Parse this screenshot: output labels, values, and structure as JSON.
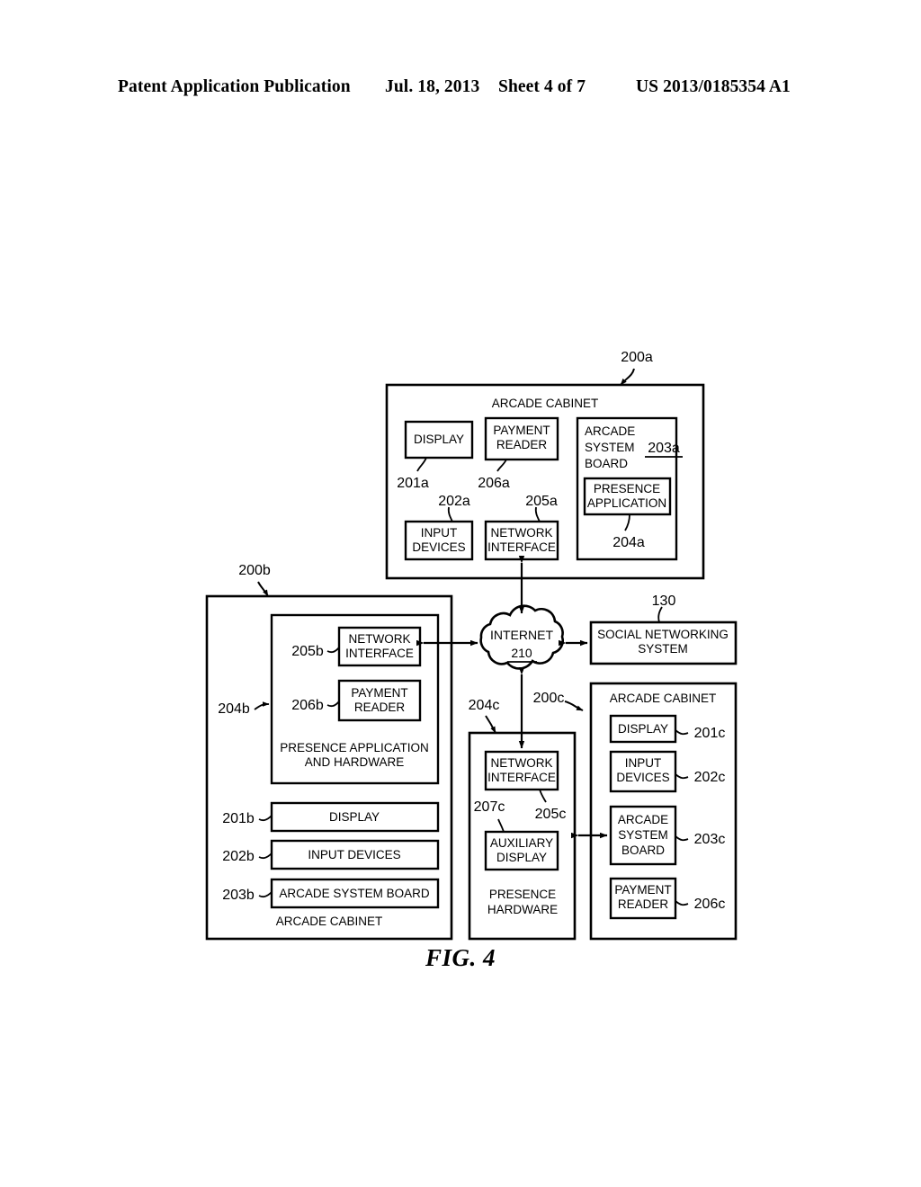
{
  "header": {
    "publication": "Patent Application Publication",
    "date": "Jul. 18, 2013",
    "sheet": "Sheet 4 of 7",
    "number": "US 2013/0185354 A1"
  },
  "figure": {
    "caption": "FIG. 4",
    "blocks": {
      "cabinet_a": {
        "ref": "200a",
        "title": "ARCADE CABINET",
        "display": {
          "label": "DISPLAY",
          "ref": "201a"
        },
        "payment_reader": {
          "label_line1": "PAYMENT",
          "label_line2": "READER",
          "ref": "206a"
        },
        "input_devices": {
          "label_line1": "INPUT",
          "label_line2": "DEVICES",
          "ref": "202a"
        },
        "network_interface": {
          "label_line1": "NETWORK",
          "label_line2": "INTERFACE",
          "ref": "205a"
        },
        "system_board": {
          "label_line1": "ARCADE",
          "label_line2": "SYSTEM",
          "label_line3": "BOARD",
          "ref": "203a"
        },
        "presence_application": {
          "label_line1": "PRESENCE",
          "label_line2": "APPLICATION",
          "ref": "204a"
        }
      },
      "cabinet_b": {
        "ref": "200b",
        "title": "ARCADE CABINET",
        "presence_module": {
          "label_line1": "PRESENCE APPLICATION",
          "label_line2": "AND HARDWARE",
          "ref": "204b"
        },
        "network_interface": {
          "label_line1": "NETWORK",
          "label_line2": "INTERFACE",
          "ref": "205b"
        },
        "payment_reader": {
          "label_line1": "PAYMENT",
          "label_line2": "READER",
          "ref": "206b"
        },
        "display": {
          "label": "DISPLAY",
          "ref": "201b"
        },
        "input_devices": {
          "label": "INPUT DEVICES",
          "ref": "202b"
        },
        "system_board": {
          "label": "ARCADE SYSTEM BOARD",
          "ref": "203b"
        }
      },
      "presence_hardware_c": {
        "ref": "204c",
        "title_line1": "PRESENCE",
        "title_line2": "HARDWARE",
        "network_interface": {
          "label_line1": "NETWORK",
          "label_line2": "INTERFACE",
          "ref": "205c"
        },
        "auxiliary_display": {
          "label_line1": "AUXILIARY",
          "label_line2": "DISPLAY",
          "ref": "207c"
        }
      },
      "cabinet_c": {
        "ref": "200c",
        "title": "ARCADE CABINET",
        "display": {
          "label": "DISPLAY",
          "ref": "201c"
        },
        "input_devices": {
          "label_line1": "INPUT",
          "label_line2": "DEVICES",
          "ref": "202c"
        },
        "system_board": {
          "label_line1": "ARCADE",
          "label_line2": "SYSTEM",
          "label_line3": "BOARD",
          "ref": "203c"
        },
        "payment_reader": {
          "label_line1": "PAYMENT",
          "label_line2": "READER",
          "ref": "206c"
        }
      },
      "internet": {
        "label": "INTERNET",
        "ref": "210"
      },
      "social_networking": {
        "label_line1": "SOCIAL NETWORKING",
        "label_line2": "SYSTEM",
        "ref": "130"
      }
    }
  }
}
